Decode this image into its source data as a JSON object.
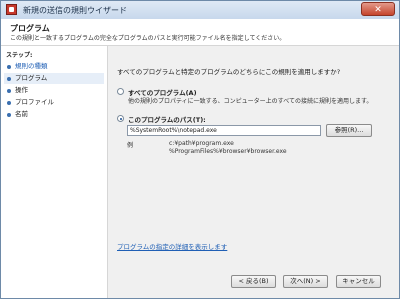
{
  "window": {
    "title": "新規の送信の規則ウイザード",
    "close_label": "✕"
  },
  "header": {
    "title": "プログラム",
    "description": "この規則と一致するプログラムの完全なプログラムのパスと実行可能ファイル名を指定してください。"
  },
  "sidebar": {
    "title": "ステップ:",
    "items": [
      {
        "label": "規則の種類"
      },
      {
        "label": "プログラム"
      },
      {
        "label": "操作"
      },
      {
        "label": "プロファイル"
      },
      {
        "label": "名前"
      }
    ]
  },
  "main": {
    "question": "すべてのプログラムと特定のプログラムのどちらにこの規則を適用しますか?",
    "option_all": {
      "label": "すべてのプログラム(A)",
      "description": "他の規則のプロパティに一致する、コンピューター上のすべての接続に規則を適用します。",
      "selected": false
    },
    "option_path": {
      "label": "このプログラムのパス(T):",
      "selected": true,
      "value": "%SystemRoot%\\notepad.exe",
      "browse_label": "参照(R)..."
    },
    "example": {
      "label": "例",
      "lines": [
        "c:¥path¥program.exe",
        "%ProgramFiles%¥browser¥browser.exe"
      ]
    },
    "help_link": "プログラムの指定の詳細を表示します"
  },
  "footer": {
    "back_label": "< 戻る(B)",
    "next_label": "次へ(N) >",
    "cancel_label": "キャンセル"
  }
}
